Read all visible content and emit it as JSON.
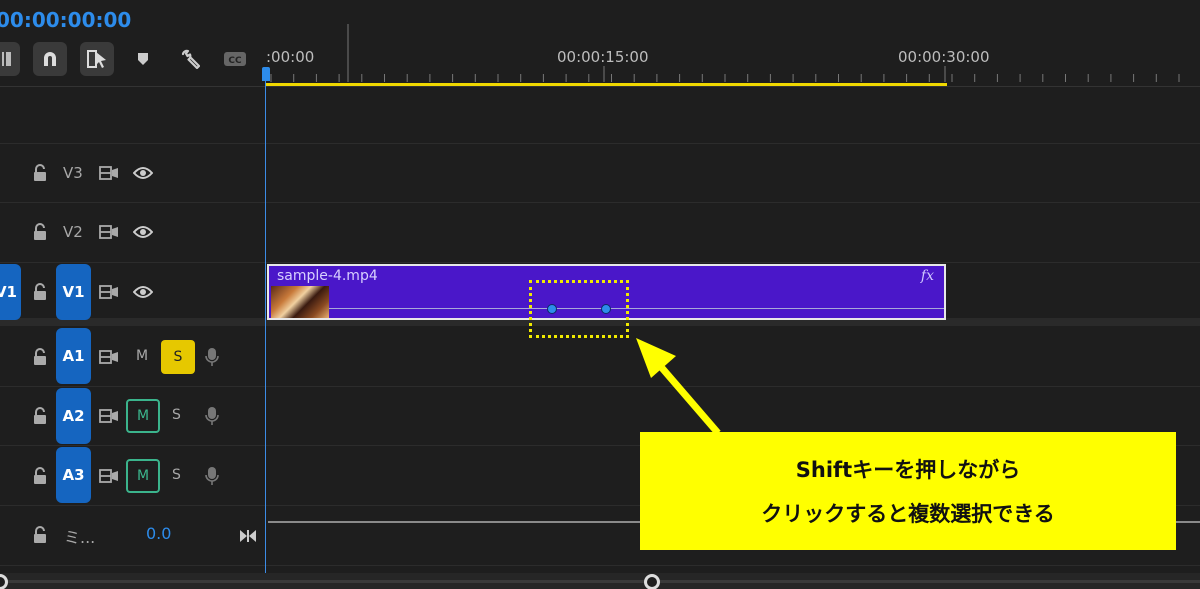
{
  "timecode": "00:00:00:00",
  "ruler": {
    "labels": [
      ":00:00",
      "00:00:15:00",
      "00:00:30:00"
    ]
  },
  "tracks": {
    "video": [
      {
        "name": "V3",
        "target": false
      },
      {
        "name": "V2",
        "target": false
      },
      {
        "name": "V1",
        "target": true,
        "source_patch": "V1"
      }
    ],
    "audio": [
      {
        "name": "A1",
        "mute": "M",
        "solo": "S",
        "solo_on": true
      },
      {
        "name": "A2",
        "mute": "M",
        "solo": "S",
        "mute_on": true
      },
      {
        "name": "A3",
        "mute": "M",
        "solo": "S",
        "mute_on": true
      }
    ],
    "master": {
      "name": "ミ...",
      "value": "0.0"
    }
  },
  "clip": {
    "name": "sample-4.mp4",
    "fx": "fx",
    "keyframes": 2
  },
  "callout": {
    "line1": "Shiftキーを押しながら",
    "line2": "クリックすると複数選択できる"
  },
  "colors": {
    "accent": "#2d8ceb",
    "clip": "#4a17c9",
    "callout": "#ffff00",
    "solo": "#e6c800",
    "mute": "#3bb48c"
  },
  "icons": [
    "insert-edit-icon",
    "snap-magnet-icon",
    "linked-selection-icon",
    "add-marker-icon",
    "wrench-icon",
    "captions-icon",
    "lock-icon",
    "track-output-icon",
    "eye-icon",
    "mic-icon"
  ]
}
